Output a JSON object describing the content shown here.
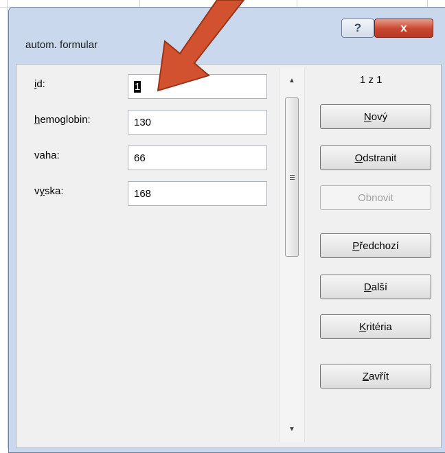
{
  "window": {
    "title": "autom. formular",
    "help_icon": "question-mark-icon",
    "close_icon": "x-close-icon",
    "help_glyph": "?",
    "close_glyph": "x"
  },
  "fields": [
    {
      "label_pre": "",
      "label_u": "i",
      "label_post": "d:",
      "value": "1"
    },
    {
      "label_pre": "",
      "label_u": "h",
      "label_post": "emoglobin:",
      "value": "130"
    },
    {
      "label_pre": "vaha:",
      "label_u": "",
      "label_post": "",
      "value": "66"
    },
    {
      "label_pre": "v",
      "label_u": "y",
      "label_post": "ska:",
      "value": "168"
    }
  ],
  "record_counter": "1 z 1",
  "buttons": [
    {
      "pre": "",
      "u": "N",
      "post": "ový",
      "enabled": true
    },
    {
      "pre": "",
      "u": "O",
      "post": "dstranit",
      "enabled": true
    },
    {
      "pre": "Obnovit",
      "u": "",
      "post": "",
      "enabled": false
    },
    {
      "pre": "",
      "u": "P",
      "post": "ředchozí",
      "enabled": true
    },
    {
      "pre": "",
      "u": "D",
      "post": "alší",
      "enabled": true
    },
    {
      "pre": "",
      "u": "K",
      "post": "ritéria",
      "enabled": true
    },
    {
      "pre": "",
      "u": "Z",
      "post": "avřít",
      "enabled": true
    }
  ],
  "colors": {
    "annotation_arrow": "#d2522f",
    "close_button": "#c8462f",
    "titlebar": "#c9d8ec"
  }
}
